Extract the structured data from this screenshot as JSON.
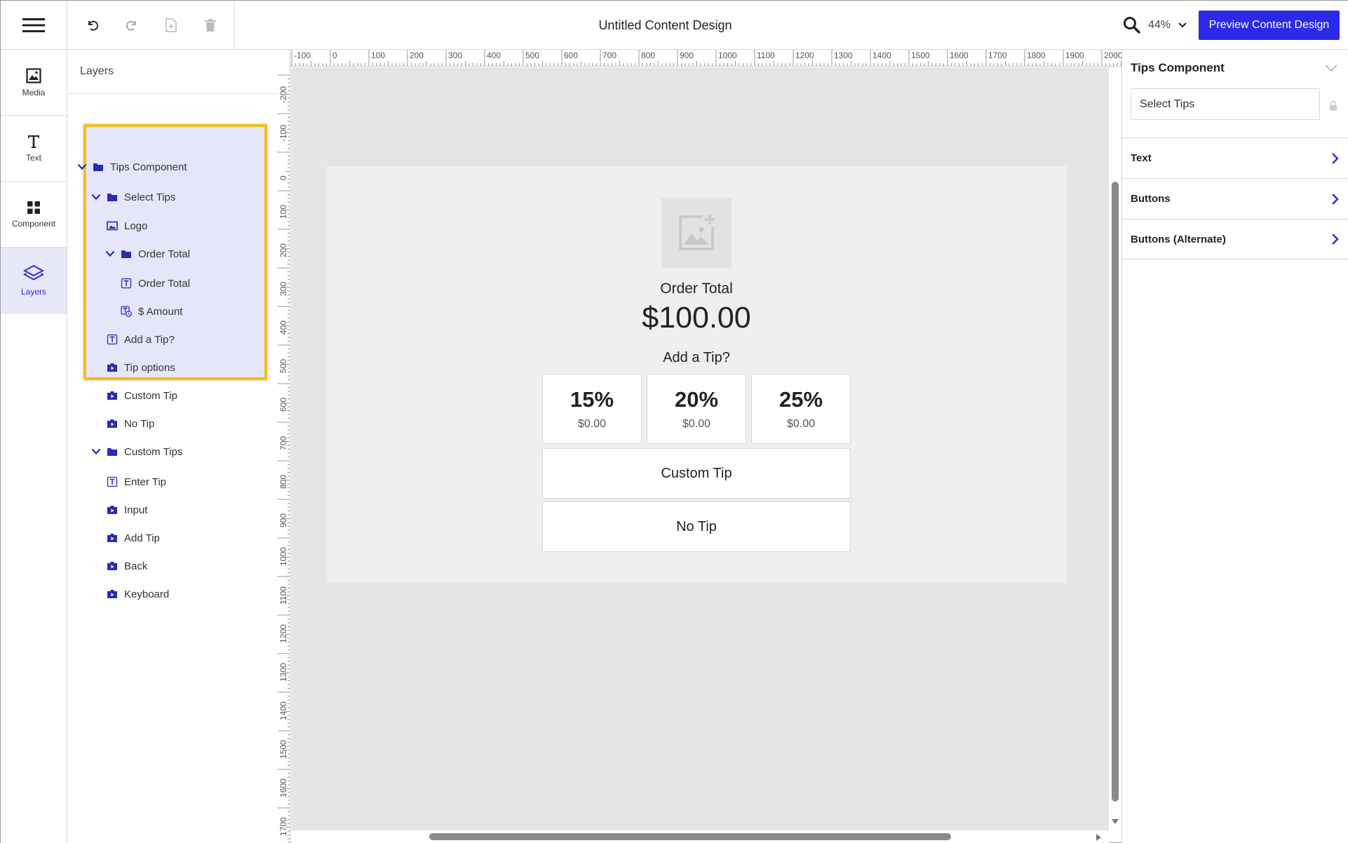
{
  "app": {
    "document_title": "Untitled Content Design",
    "zoom_level": "44%",
    "preview_button_label": "Preview Content Design"
  },
  "rail": {
    "items": [
      {
        "label": "Media",
        "icon": "image-icon"
      },
      {
        "label": "Text",
        "icon": "text-icon"
      },
      {
        "label": "Component",
        "icon": "grid-icon"
      },
      {
        "label": "Layers",
        "icon": "layers-icon",
        "active": true
      }
    ]
  },
  "layers": {
    "title": "Layers",
    "tree": [
      {
        "label": "Tips Component",
        "type": "folder",
        "expanded": true
      },
      {
        "label": "Select Tips",
        "type": "folder",
        "expanded": true
      },
      {
        "label": "Logo",
        "type": "image"
      },
      {
        "label": "Order Total",
        "type": "folder",
        "expanded": true
      },
      {
        "label": "Order Total",
        "type": "text"
      },
      {
        "label": "$ Amount",
        "type": "dynamic-text"
      },
      {
        "label": "Add a Tip?",
        "type": "text"
      },
      {
        "label": "Tip options",
        "type": "component"
      },
      {
        "label": "Custom Tip",
        "type": "component"
      },
      {
        "label": "No Tip",
        "type": "component"
      },
      {
        "label": "Custom Tips",
        "type": "folder",
        "expanded": true
      },
      {
        "label": "Enter Tip",
        "type": "text"
      },
      {
        "label": "Input",
        "type": "component"
      },
      {
        "label": "Add Tip",
        "type": "component"
      },
      {
        "label": "Back",
        "type": "component"
      },
      {
        "label": "Keyboard",
        "type": "component"
      }
    ]
  },
  "rulers": {
    "top": [
      "-100",
      "0",
      "100",
      "200",
      "300",
      "400",
      "500",
      "600",
      "700",
      "800",
      "900",
      "1000",
      "1100",
      "1200",
      "1300",
      "1400",
      "1500",
      "1600",
      "1700",
      "1800",
      "1900",
      "2000"
    ],
    "left": [
      "-200",
      "-100",
      "0",
      "100",
      "200",
      "300",
      "400",
      "500",
      "600",
      "700",
      "800",
      "900",
      "1000",
      "1100",
      "1200",
      "1300",
      "1400",
      "1500",
      "1600",
      "1700"
    ]
  },
  "artboard": {
    "order_total_label": "Order Total",
    "amount": "$100.00",
    "add_tip_label": "Add a Tip?",
    "tip_options": [
      {
        "percent": "15%",
        "amount": "$0.00"
      },
      {
        "percent": "20%",
        "amount": "$0.00"
      },
      {
        "percent": "25%",
        "amount": "$0.00"
      }
    ],
    "custom_tip_label": "Custom Tip",
    "no_tip_label": "No Tip"
  },
  "properties": {
    "title": "Tips Component",
    "name_value": "Select Tips",
    "sections": [
      {
        "label": "Text"
      },
      {
        "label": "Buttons"
      },
      {
        "label": "Buttons (Alternate)"
      }
    ]
  },
  "colors": {
    "accent": "#2a2ae8",
    "highlight_border": "#f3bf1f",
    "highlight_fill": "#e6e6fb"
  }
}
